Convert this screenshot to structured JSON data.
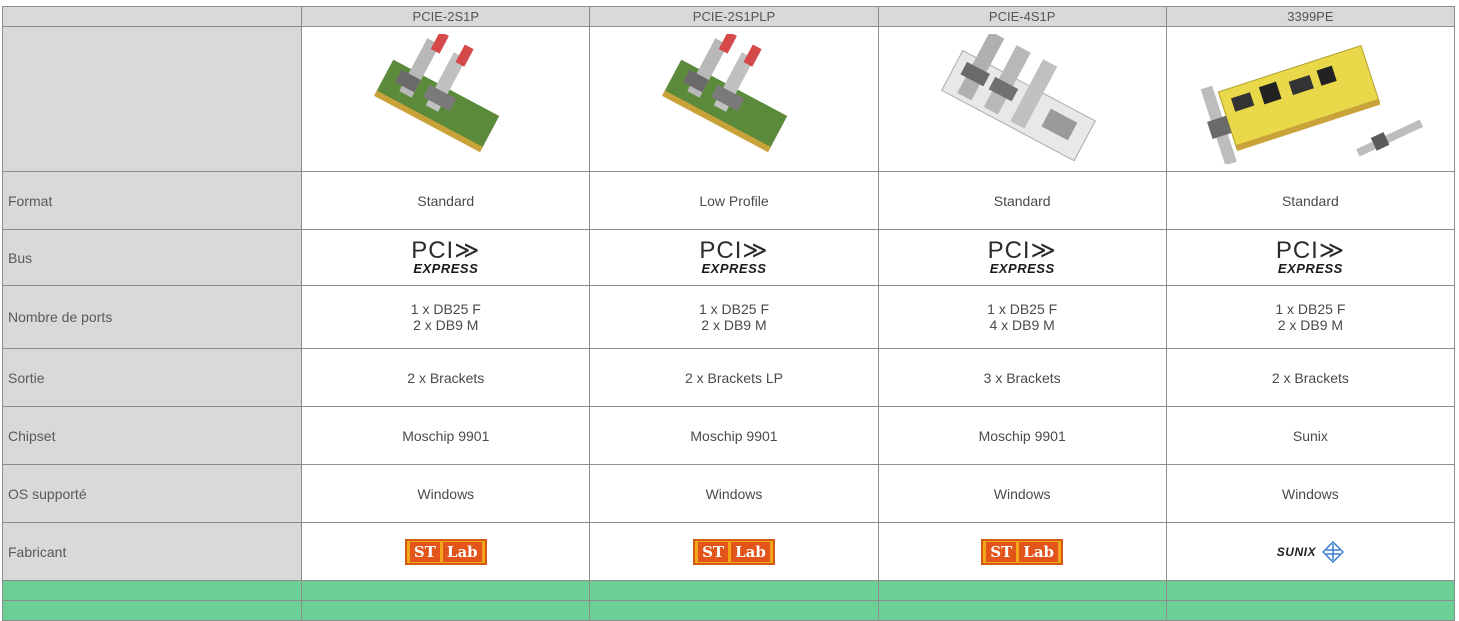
{
  "products": [
    {
      "model": "PCIE-2S1P",
      "format": "Standard",
      "ports": [
        "1 x DB25 F",
        "2 x DB9 M"
      ],
      "sortie": "2 x Brackets",
      "chipset": "Moschip 9901",
      "os": "Windows",
      "maker": "st-lab-logo",
      "card": "green"
    },
    {
      "model": "PCIE-2S1PLP",
      "format": "Low Profile",
      "ports": [
        "1 x DB25 F",
        "2 x DB9 M"
      ],
      "sortie": "2 x Brackets LP",
      "chipset": "Moschip 9901",
      "os": "Windows",
      "maker": "st-lab-logo",
      "card": "green"
    },
    {
      "model": "PCIE-4S1P",
      "format": "Standard",
      "ports": [
        "1 x DB25 F",
        "4 x DB9 M"
      ],
      "sortie": "3 x Brackets",
      "chipset": "Moschip 9901",
      "os": "Windows",
      "maker": "st-lab-logo",
      "card": "white"
    },
    {
      "model": "3399PE",
      "format": "Standard",
      "ports": [
        "1 x DB25 F",
        "2 x DB9 M"
      ],
      "sortie": "2 x Brackets",
      "chipset": "Sunix",
      "os": "Windows",
      "maker": "sunix-logo",
      "card": "yellow"
    }
  ],
  "labels": {
    "format": "Format",
    "bus": "Bus",
    "ports": "Nombre de ports",
    "sortie": "Sortie",
    "chipset": "Chipset",
    "os": "OS supporté",
    "maker": "Fabricant"
  },
  "logos": {
    "pci_top": "PCI",
    "pci_bottom": "EXPRESS",
    "stlab_a": "ST",
    "stlab_b": "Lab",
    "sunix": "SUNIX"
  },
  "colors": {
    "label_bg": "#d9d9d9",
    "footer_green": "#6ccf95",
    "stlab_orange": "#e2541a"
  }
}
